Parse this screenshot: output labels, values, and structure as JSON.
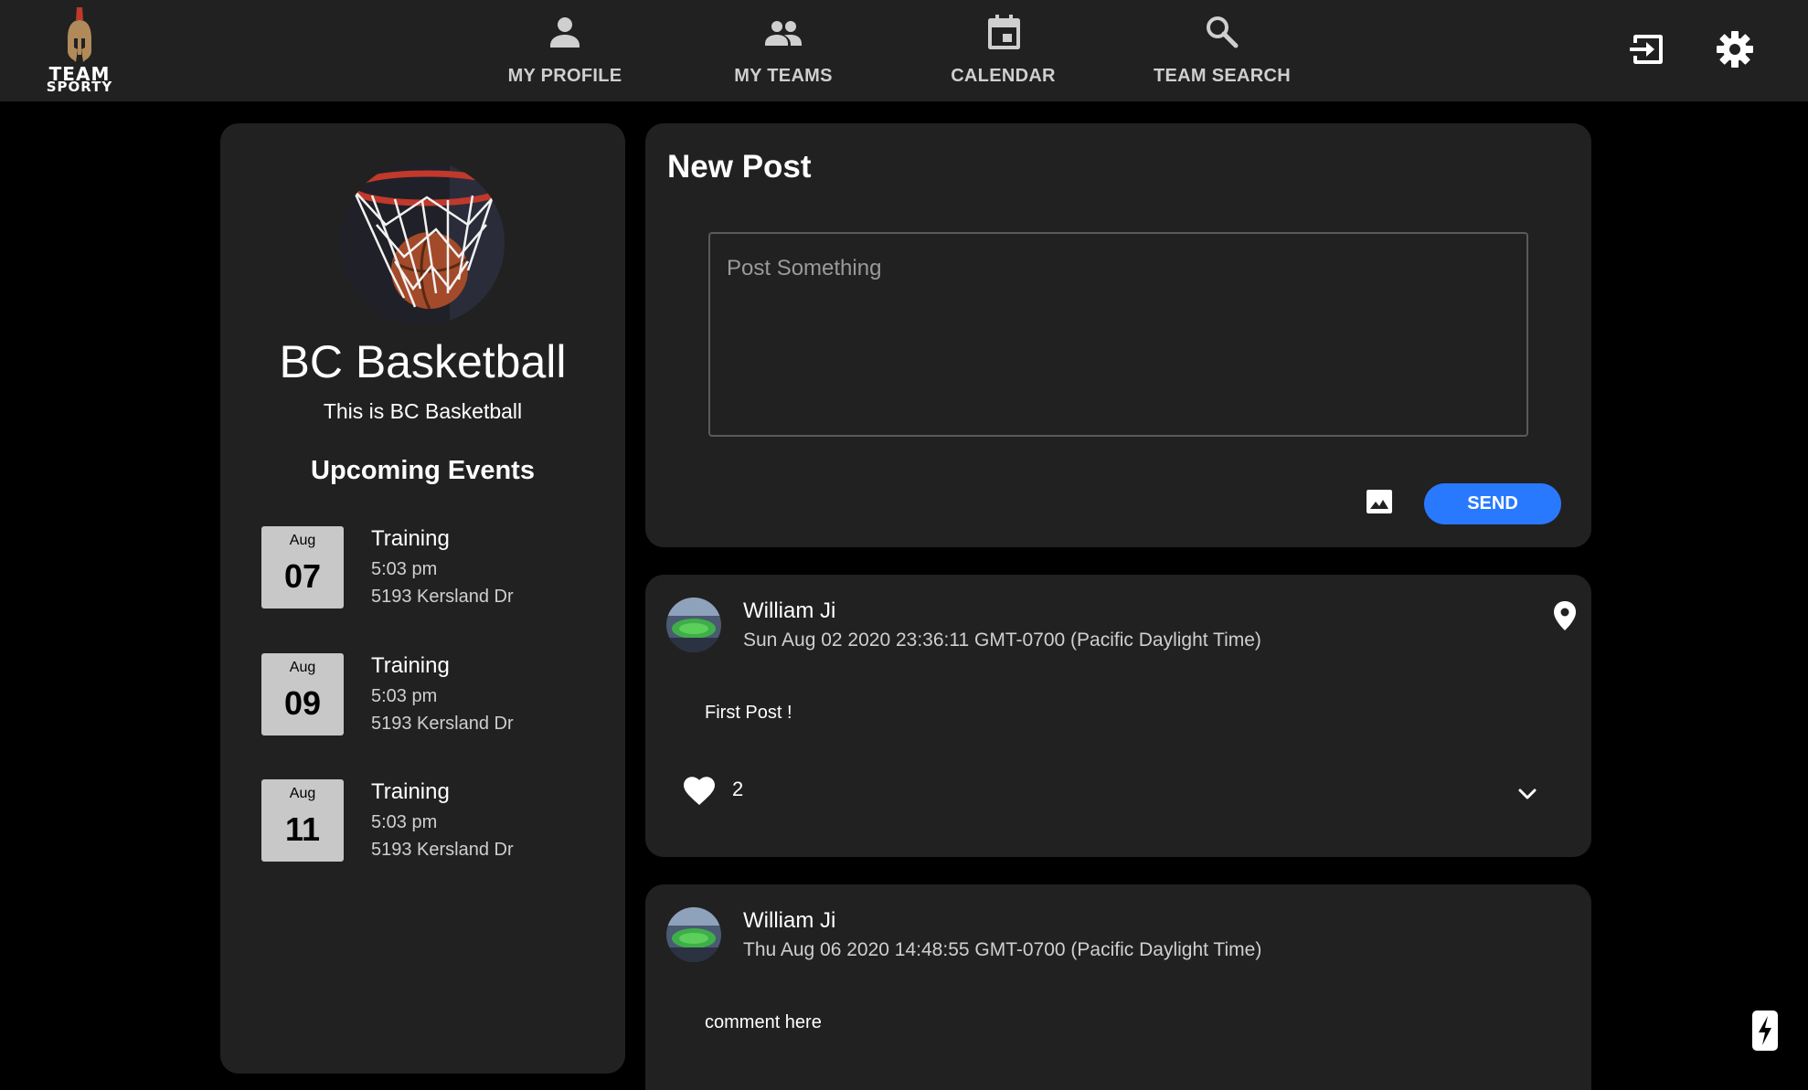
{
  "brand": {
    "line1": "TEAM",
    "line2": "SPORTY"
  },
  "nav": {
    "my_profile": "MY PROFILE",
    "my_teams": "MY TEAMS",
    "calendar": "CALENDAR",
    "team_search": "TEAM SEARCH"
  },
  "team": {
    "name": "BC Basketball",
    "description": "This is BC Basketball",
    "events_title": "Upcoming Events",
    "events": [
      {
        "month": "Aug",
        "day": "07",
        "title": "Training",
        "time": "5:03 pm",
        "location": "5193 Kersland Dr"
      },
      {
        "month": "Aug",
        "day": "09",
        "title": "Training",
        "time": "5:03 pm",
        "location": "5193 Kersland Dr"
      },
      {
        "month": "Aug",
        "day": "11",
        "title": "Training",
        "time": "5:03 pm",
        "location": "5193 Kersland Dr"
      }
    ]
  },
  "new_post": {
    "title": "New Post",
    "placeholder": "Post Something",
    "send_label": "SEND"
  },
  "posts": [
    {
      "author": "William Ji",
      "date": "Sun Aug 02 2020 23:36:11 GMT-0700 (Pacific Daylight Time)",
      "body": "First Post !",
      "likes": "2"
    },
    {
      "author": "William Ji",
      "date": "Thu Aug 06 2020 14:48:55 GMT-0700 (Pacific Daylight Time)",
      "body": "comment here"
    }
  ],
  "colors": {
    "background": "#000000",
    "surface": "#212121",
    "accent": "#2979ff",
    "date_box": "#c8c8c8"
  },
  "icons": {
    "logo": "spartan-helmet-icon",
    "my_profile": "person-icon",
    "my_teams": "people-icon",
    "calendar": "calendar-icon",
    "team_search": "search-icon",
    "logout": "logout-icon",
    "settings": "gear-icon",
    "image": "image-icon",
    "location": "location-pin-icon",
    "like": "heart-icon",
    "expand": "chevron-down-icon",
    "flash": "lightning-icon"
  }
}
